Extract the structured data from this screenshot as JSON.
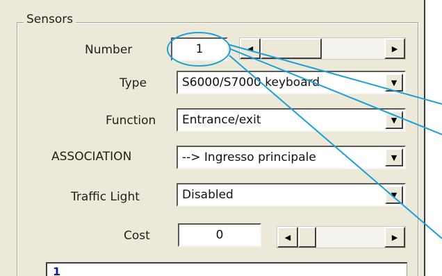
{
  "group": {
    "title": "Sensors"
  },
  "fields": {
    "number": {
      "label": "Number",
      "value": "1"
    },
    "type": {
      "label": "Type",
      "value": "S6000/S7000 keyboard"
    },
    "function": {
      "label": "Function",
      "value": "Entrance/exit"
    },
    "association": {
      "label": "ASSOCIATION",
      "value": "--> Ingresso principale"
    },
    "traffic_light": {
      "label": "Traffic Light",
      "value": "Disabled"
    },
    "cost": {
      "label": "Cost",
      "value": "0"
    }
  },
  "list": {
    "first_item": "1"
  },
  "glyphs": {
    "arrow_left": "◀",
    "arrow_right": "▶",
    "arrow_down": "▼"
  },
  "colors": {
    "annotation": "#1a9fd8",
    "panel_bg": "#ece9d8"
  },
  "icons": {
    "dropdown": "chevron-down-icon",
    "scroll_left": "arrow-left-icon",
    "scroll_right": "arrow-right-icon"
  }
}
